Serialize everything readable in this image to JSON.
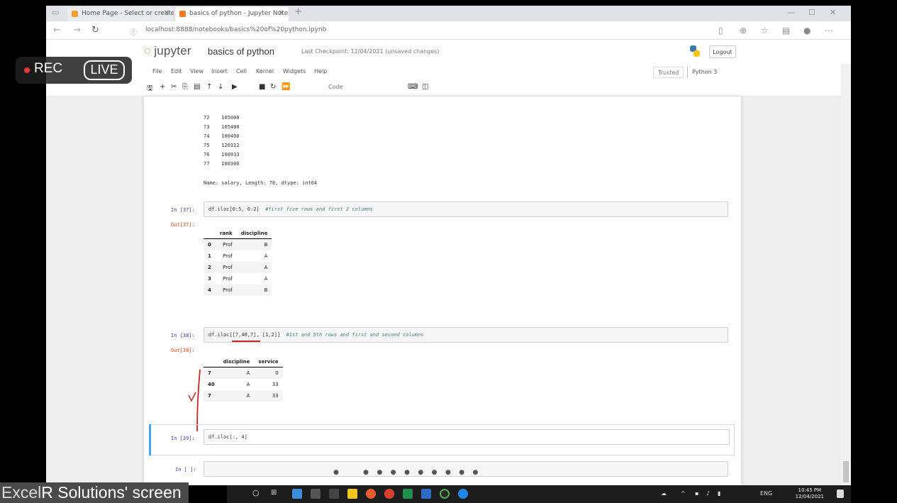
{
  "browser": {
    "tabs": [
      {
        "label": "Home Page - Select or create",
        "icon_color": "#f0a030"
      },
      {
        "label": "basics of python - Jupyter Note",
        "icon_color": "#f37726"
      }
    ],
    "new_tab": "+",
    "url": "localhost:8888/notebooks/basics%20of%20python.ipynb",
    "window_controls": [
      "—",
      "☐",
      "✕"
    ]
  },
  "jupyter": {
    "logo": "jupyter",
    "notebook_title": "basics of python",
    "meta": "Last Checkpoint: 12/04/2021 (unsaved changes)",
    "logout": "Logout",
    "menu": [
      "File",
      "Edit",
      "View",
      "Insert",
      "Cell",
      "Kernel",
      "Widgets",
      "Help"
    ],
    "trusted": "Trusted",
    "kernel": "Python 3",
    "celltype": "Code"
  },
  "cells": {
    "series_tail": [
      "72    105000",
      "73    105400",
      "74    100400",
      "75    120312",
      "76    100933",
      "77    100300",
      "Name: salary, Length: 78, dtype: int64"
    ],
    "cell1": {
      "in_prompt": "In [37]:",
      "code": "df.iloc[0:5, 0:2]",
      "comment": "#first five rows and first 2 columns",
      "out_prompt": "Out[37]:"
    },
    "table1": {
      "columns": [
        "",
        "rank",
        "discipline"
      ],
      "rows": [
        [
          "0",
          "Prof",
          "B"
        ],
        [
          "1",
          "Prof",
          "A"
        ],
        [
          "2",
          "Prof",
          "A"
        ],
        [
          "3",
          "Prof",
          "A"
        ],
        [
          "4",
          "Prof",
          "B"
        ]
      ]
    },
    "cell2": {
      "in_prompt": "In [38]:",
      "code_a": "df.iloc[",
      "code_b": "[7,40,7]",
      "code_c": ", [1,2]]",
      "comment": "#1st and 5th rows and first and second columns",
      "out_prompt": "Out[38]:"
    },
    "table2": {
      "columns": [
        "",
        "discipline",
        "service"
      ],
      "rows": [
        [
          "7",
          "A",
          "0"
        ],
        [
          "40",
          "A",
          "33"
        ],
        [
          "7",
          "A",
          "33"
        ]
      ]
    },
    "cell3": {
      "in_prompt": "In [39]:",
      "code": "df.iloc[:, 4]"
    },
    "cell4": {
      "in_prompt": "In [ ]:"
    }
  },
  "overlay": {
    "rec": "REC",
    "live": "LIVE",
    "brand_a": "Excel",
    "brand_b": "R Solutions' screen"
  },
  "taskbar": {
    "clock_time": "10:45 PM",
    "clock_date": "12/04/2021",
    "lang": "ENG"
  },
  "colors": {
    "jupyter_orange": "#f37726",
    "selected_cell": "#42a5f5",
    "annotation_red": "#c62828"
  }
}
